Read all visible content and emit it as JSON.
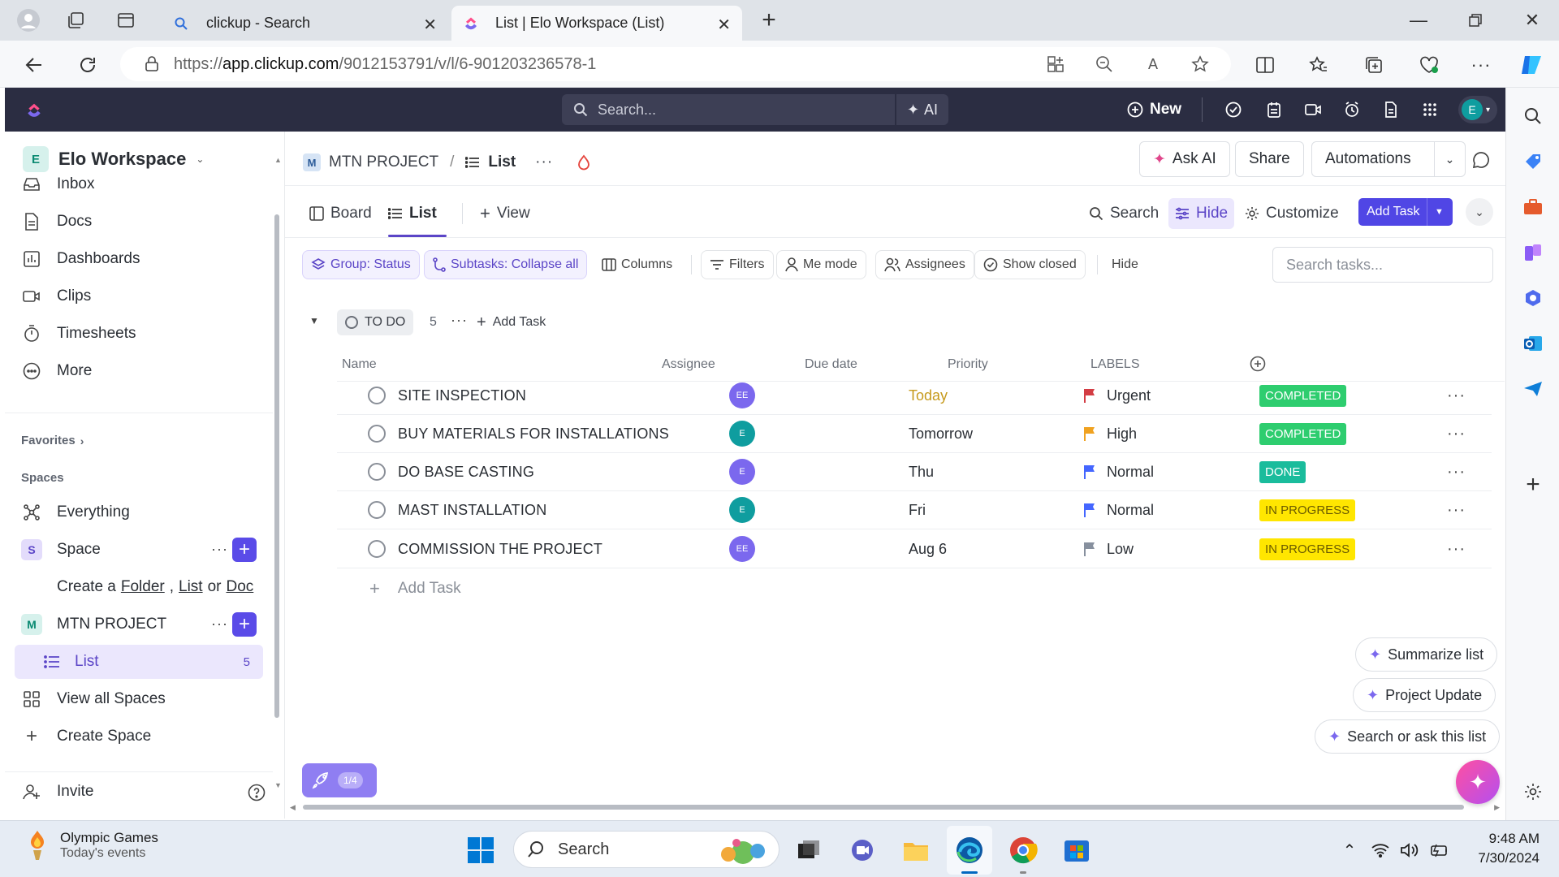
{
  "browser": {
    "tabs": [
      {
        "label": "clickup - Search"
      },
      {
        "label": "List | Elo Workspace (List)"
      }
    ],
    "url": "https://app.clickup.com/9012153791/v/l/6-901203236578-1",
    "url_host": "app.clickup.com",
    "url_prefix": "https://",
    "url_path": "/9012153791/v/l/6-901203236578-1"
  },
  "header": {
    "search_placeholder": "Search...",
    "ai_label": "AI",
    "new_label": "New",
    "avatar_initial": "E"
  },
  "sidebar": {
    "workspace_initial": "E",
    "workspace_name": "Elo Workspace",
    "nav": [
      "Inbox",
      "Docs",
      "Dashboards",
      "Clips",
      "Timesheets",
      "More"
    ],
    "favorites_label": "Favorites",
    "spaces_label": "Spaces",
    "everything_label": "Everything",
    "space_initial": "S",
    "space_name": "Space",
    "create_prefix": "Create a",
    "create_folder": "Folder",
    "create_list": "List",
    "create_or": "or",
    "create_doc": "Doc",
    "project_initial": "M",
    "project_name": "MTN PROJECT",
    "list_name": "List",
    "list_count": "5",
    "view_all_spaces": "View all Spaces",
    "create_space": "Create Space",
    "invite": "Invite"
  },
  "breadcrumb": {
    "project_initial": "M",
    "project": "MTN PROJECT",
    "separator": "/",
    "list": "List"
  },
  "top_actions": {
    "ask_ai": "Ask AI",
    "share": "Share",
    "automations": "Automations"
  },
  "views": {
    "board": "Board",
    "list": "List",
    "add_view": "View",
    "search": "Search",
    "hide": "Hide",
    "customize": "Customize",
    "add_task": "Add Task"
  },
  "filters": {
    "group": "Group: Status",
    "subtasks": "Subtasks: Collapse all",
    "columns": "Columns",
    "filters": "Filters",
    "me_mode": "Me mode",
    "assignees": "Assignees",
    "show_closed": "Show closed",
    "hide": "Hide",
    "search_placeholder": "Search tasks..."
  },
  "group": {
    "status": "TO DO",
    "count": "5",
    "add_task": "Add Task"
  },
  "columns": {
    "name": "Name",
    "assignee": "Assignee",
    "due": "Due date",
    "priority": "Priority",
    "labels": "LABELS"
  },
  "tasks": [
    {
      "name": "SITE INSPECTION",
      "assignee": "EE",
      "assignee_color": "#7b68ee",
      "due": "Today",
      "due_color": "#c69a1c",
      "priority": "Urgent",
      "flag_color": "#d33d44",
      "label": "COMPLETED",
      "label_bg": "#2ecd6f",
      "label_fg": "#ffffff"
    },
    {
      "name": "BUY MATERIALS FOR INSTALLATIONS",
      "assignee": "E",
      "assignee_color": "#0f9d9f",
      "due": "Tomorrow",
      "due_color": "#2a2e34",
      "priority": "High",
      "flag_color": "#f0a220",
      "label": "COMPLETED",
      "label_bg": "#2ecd6f",
      "label_fg": "#ffffff"
    },
    {
      "name": "DO BASE CASTING",
      "assignee": "E",
      "assignee_color": "#7b68ee",
      "due": "Thu",
      "due_color": "#2a2e34",
      "priority": "Normal",
      "flag_color": "#4466ff",
      "label": "DONE",
      "label_bg": "#1abc9c",
      "label_fg": "#ffffff"
    },
    {
      "name": "MAST INSTALLATION",
      "assignee": "E",
      "assignee_color": "#0f9d9f",
      "due": "Fri",
      "due_color": "#2a2e34",
      "priority": "Normal",
      "flag_color": "#4466ff",
      "label": "IN PROGRESS",
      "label_bg": "#ffe600",
      "label_fg": "#6b5b00"
    },
    {
      "name": "COMMISSION THE PROJECT",
      "assignee": "EE",
      "assignee_color": "#7b68ee",
      "due": "Aug 6",
      "due_color": "#2a2e34",
      "priority": "Low",
      "flag_color": "#87909e",
      "label": "IN PROGRESS",
      "label_bg": "#ffe600",
      "label_fg": "#6b5b00"
    }
  ],
  "add_task_row": "Add Task",
  "ai_suggestions": [
    "Summarize list",
    "Project Update",
    "Search or ask this list"
  ],
  "progress_badge": "1/4",
  "taskbar": {
    "news_title": "Olympic Games",
    "news_sub": "Today's events",
    "search": "Search",
    "time": "9:48 AM",
    "date": "7/30/2024"
  },
  "colors": {
    "accent": "#7b68ee",
    "add_task_button": "#5046e5",
    "app_header": "#2b2d42"
  }
}
